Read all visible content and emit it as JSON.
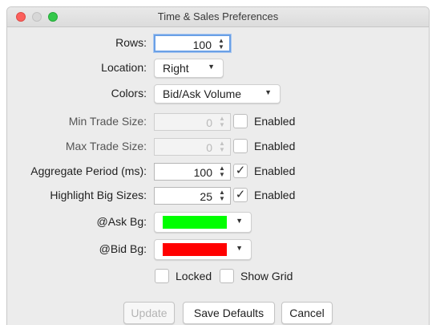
{
  "window": {
    "title": "Time & Sales Preferences"
  },
  "form": {
    "rows": {
      "label": "Rows:",
      "value": "100"
    },
    "location": {
      "label": "Location:",
      "selected": "Right"
    },
    "colors": {
      "label": "Colors:",
      "selected": "Bid/Ask Volume"
    },
    "min_trade_size": {
      "label": "Min Trade Size:",
      "value": "0",
      "enabled": false,
      "checkbox_label": "Enabled"
    },
    "max_trade_size": {
      "label": "Max Trade Size:",
      "value": "0",
      "enabled": false,
      "checkbox_label": "Enabled"
    },
    "aggregate_period": {
      "label": "Aggregate Period (ms):",
      "value": "100",
      "enabled": true,
      "checkbox_label": "Enabled"
    },
    "highlight_big_sizes": {
      "label": "Highlight Big Sizes:",
      "value": "25",
      "enabled": true,
      "checkbox_label": "Enabled"
    },
    "ask_bg": {
      "label": "@Ask Bg:",
      "color": "#00ff00"
    },
    "bid_bg": {
      "label": "@Bid Bg:",
      "color": "#ff0000"
    },
    "locked": {
      "label": "Locked",
      "checked": false
    },
    "show_grid": {
      "label": "Show Grid",
      "checked": false
    }
  },
  "buttons": {
    "update": "Update",
    "save_defaults": "Save Defaults",
    "cancel": "Cancel"
  },
  "glyphs": {
    "check": "✓",
    "spin_up": "▲",
    "spin_down": "▼",
    "caret": "▼"
  }
}
